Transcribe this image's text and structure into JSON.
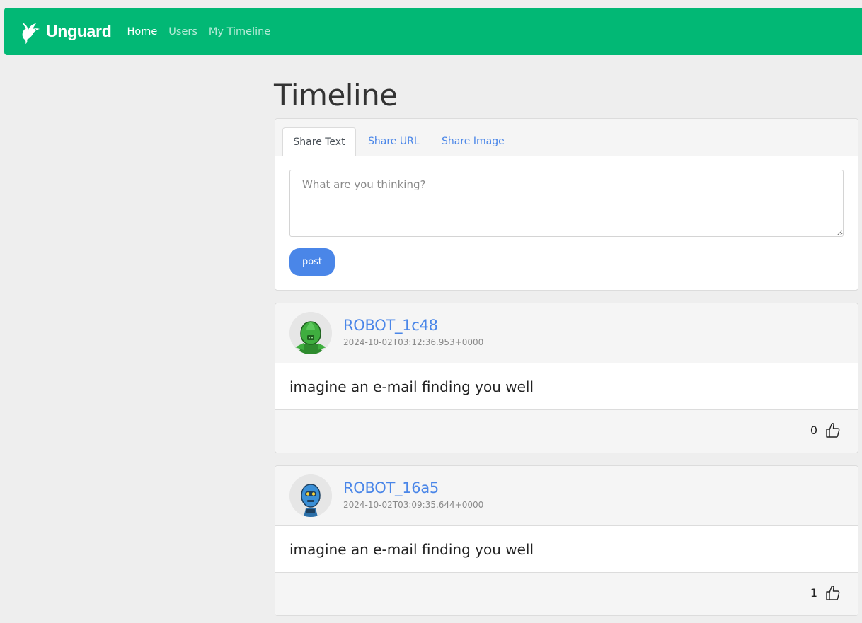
{
  "navbar": {
    "brand": "Unguard",
    "links": [
      {
        "label": "Home",
        "active": true
      },
      {
        "label": "Users",
        "active": false
      },
      {
        "label": "My Timeline",
        "active": false
      }
    ],
    "bg_color": "#02b875"
  },
  "page": {
    "title": "Timeline"
  },
  "composer": {
    "tabs": [
      {
        "label": "Share Text",
        "active": true
      },
      {
        "label": "Share URL",
        "active": false
      },
      {
        "label": "Share Image",
        "active": false
      }
    ],
    "placeholder": "What are you thinking?",
    "value": "",
    "post_label": "post"
  },
  "posts": [
    {
      "username": "ROBOT_1c48",
      "timestamp": "2024-10-02T03:12:36.953+0000",
      "body": "imagine an e-mail finding you well",
      "likes": "0",
      "avatar_color": "#3fae3f",
      "avatar_icon": "robot-avatar-green"
    },
    {
      "username": "ROBOT_16a5",
      "timestamp": "2024-10-02T03:09:35.644+0000",
      "body": "imagine an e-mail finding you well",
      "likes": "1",
      "avatar_color": "#3a8fd6",
      "avatar_icon": "robot-avatar-blue"
    }
  ],
  "colors": {
    "accent": "#4a86e8",
    "brand": "#02b875"
  }
}
